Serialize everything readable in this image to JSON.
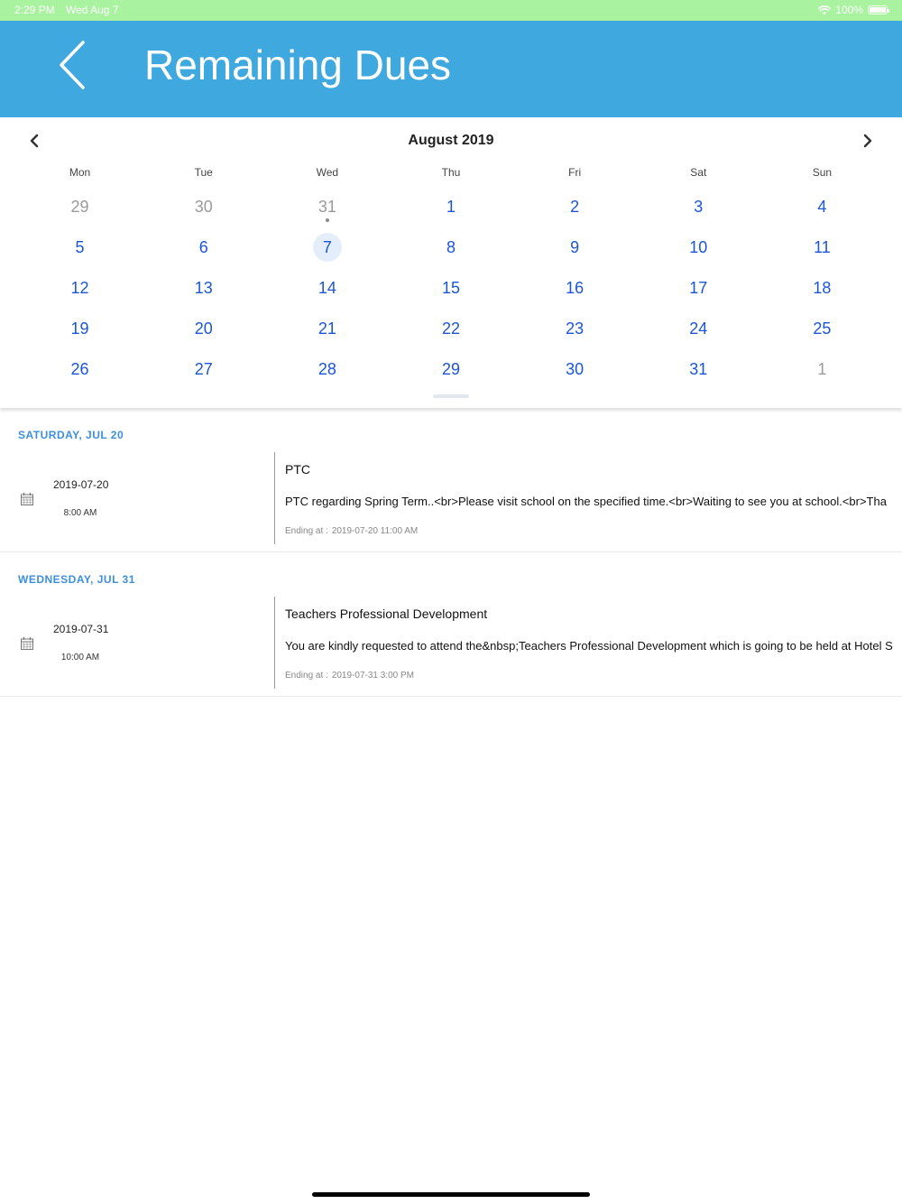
{
  "status_bar": {
    "time": "2:29 PM",
    "date": "Wed Aug 7",
    "battery": "100%"
  },
  "header": {
    "title": "Remaining Dues",
    "back_icon": "chevron-left-icon"
  },
  "calendar": {
    "month_label": "August 2019",
    "weekdays": [
      "Mon",
      "Tue",
      "Wed",
      "Thu",
      "Fri",
      "Sat",
      "Sun"
    ],
    "weeks": [
      [
        {
          "day": "29",
          "muted": true
        },
        {
          "day": "30",
          "muted": true
        },
        {
          "day": "31",
          "muted": true,
          "dot": true
        },
        {
          "day": "1"
        },
        {
          "day": "2"
        },
        {
          "day": "3"
        },
        {
          "day": "4"
        }
      ],
      [
        {
          "day": "5"
        },
        {
          "day": "6"
        },
        {
          "day": "7",
          "selected": true
        },
        {
          "day": "8"
        },
        {
          "day": "9"
        },
        {
          "day": "10"
        },
        {
          "day": "11"
        }
      ],
      [
        {
          "day": "12"
        },
        {
          "day": "13"
        },
        {
          "day": "14"
        },
        {
          "day": "15"
        },
        {
          "day": "16"
        },
        {
          "day": "17"
        },
        {
          "day": "18"
        }
      ],
      [
        {
          "day": "19"
        },
        {
          "day": "20"
        },
        {
          "day": "21"
        },
        {
          "day": "22"
        },
        {
          "day": "23"
        },
        {
          "day": "24"
        },
        {
          "day": "25"
        }
      ],
      [
        {
          "day": "26"
        },
        {
          "day": "27"
        },
        {
          "day": "28"
        },
        {
          "day": "29"
        },
        {
          "day": "30"
        },
        {
          "day": "31"
        },
        {
          "day": "1",
          "muted": true
        }
      ]
    ],
    "colors": {
      "day": "#1a56d8",
      "muted": "#9a9a9a",
      "selected_bg": "#e4eefb"
    }
  },
  "events": [
    {
      "section": "SATURDAY, JUL 20",
      "date": "2019-07-20",
      "time": "8:00 AM",
      "title": "PTC",
      "description": "PTC regarding Spring Term..<br>Please visit school on the specified time.<br>Waiting to see you at school.<br>Tha",
      "ending_label": "Ending at :",
      "ending_value": "2019-07-20 11:00 AM"
    },
    {
      "section": "WEDNESDAY, JUL 31",
      "date": "2019-07-31",
      "time": "10:00 AM",
      "title": "Teachers Professional Development",
      "description": "You are kindly requested to attend the&nbsp;Teachers Professional Development which is going to be held at Hotel S",
      "ending_label": "Ending at :",
      "ending_value": "2019-07-31 3:00 PM"
    }
  ],
  "theme": {
    "header_bg": "#3fa9df",
    "status_bar_bg": "#a9f2a0",
    "section_color": "#3b8fe0"
  }
}
